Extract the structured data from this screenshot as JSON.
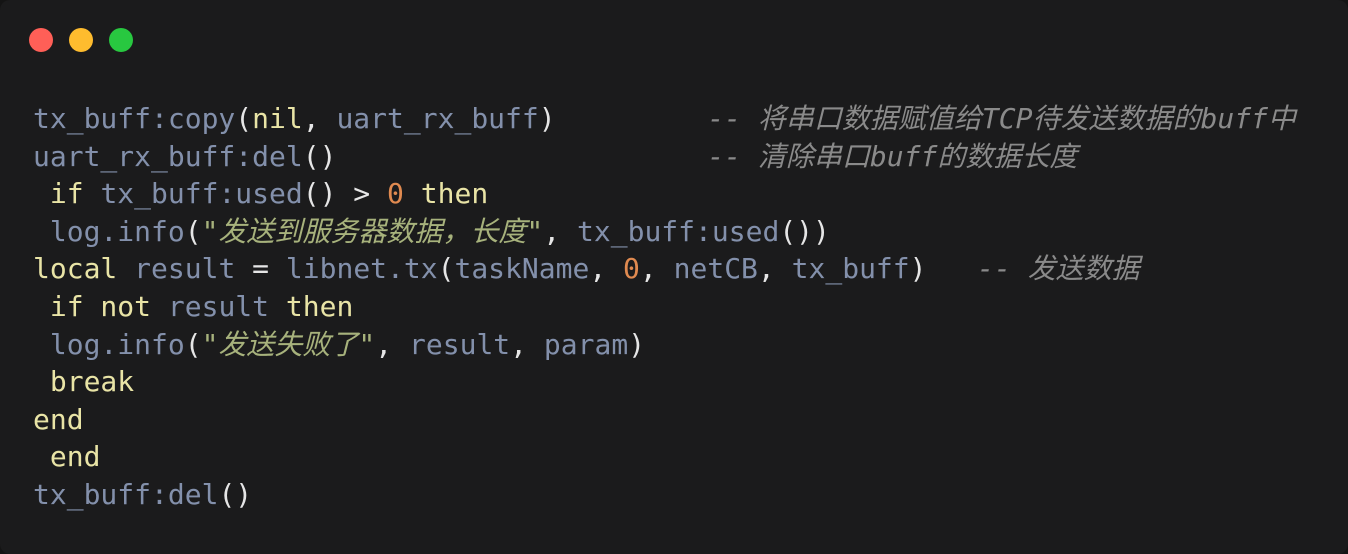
{
  "window": {
    "buttons": [
      {
        "name": "close-button",
        "color": "#ff5f57"
      },
      {
        "name": "minimize-button",
        "color": "#febc2e"
      },
      {
        "name": "maximize-button",
        "color": "#28c840"
      }
    ]
  },
  "colors": {
    "ident": "#8390ab",
    "keyword": "#e9e4a6",
    "number": "#e08a50",
    "string": "#a7b27c",
    "comment": "#8a8a8a",
    "punct": "#e6e6e6"
  },
  "code": {
    "language": "lua",
    "lines": [
      [
        [
          "ident",
          "tx_buff:copy"
        ],
        [
          "punct",
          "("
        ],
        [
          "keyword",
          "nil"
        ],
        [
          "punct",
          ", "
        ],
        [
          "ident",
          "uart_rx_buff"
        ],
        [
          "punct",
          ")"
        ],
        [
          "punct",
          "         "
        ],
        [
          "comment",
          "-- 将串口数据赋值给TCP待发送数据的buff中"
        ]
      ],
      [
        [
          "ident",
          "uart_rx_buff:del"
        ],
        [
          "punct",
          "()"
        ],
        [
          "punct",
          "                      "
        ],
        [
          "comment",
          "-- 清除串口buff的数据长度"
        ]
      ],
      [
        [
          "punct",
          " "
        ],
        [
          "keyword",
          "if"
        ],
        [
          "punct",
          " "
        ],
        [
          "ident",
          "tx_buff:used"
        ],
        [
          "punct",
          "() > "
        ],
        [
          "number",
          "0"
        ],
        [
          "punct",
          " "
        ],
        [
          "keyword",
          "then"
        ]
      ],
      [
        [
          "punct",
          " "
        ],
        [
          "ident",
          "log.info"
        ],
        [
          "punct",
          "("
        ],
        [
          "string",
          "\"发送到服务器数据，长度\""
        ],
        [
          "punct",
          ", "
        ],
        [
          "ident",
          "tx_buff:used"
        ],
        [
          "punct",
          "())"
        ]
      ],
      [
        [
          "keyword",
          "local"
        ],
        [
          "punct",
          " "
        ],
        [
          "ident",
          "result"
        ],
        [
          "punct",
          " = "
        ],
        [
          "ident",
          "libnet.tx"
        ],
        [
          "punct",
          "("
        ],
        [
          "ident",
          "taskName"
        ],
        [
          "punct",
          ", "
        ],
        [
          "number",
          "0"
        ],
        [
          "punct",
          ", "
        ],
        [
          "ident",
          "netCB"
        ],
        [
          "punct",
          ", "
        ],
        [
          "ident",
          "tx_buff"
        ],
        [
          "punct",
          ")"
        ],
        [
          "punct",
          "   "
        ],
        [
          "comment",
          "-- 发送数据"
        ]
      ],
      [
        [
          "punct",
          " "
        ],
        [
          "keyword",
          "if not"
        ],
        [
          "punct",
          " "
        ],
        [
          "ident",
          "result"
        ],
        [
          "punct",
          " "
        ],
        [
          "keyword",
          "then"
        ]
      ],
      [
        [
          "punct",
          " "
        ],
        [
          "ident",
          "log.info"
        ],
        [
          "punct",
          "("
        ],
        [
          "string",
          "\"发送失败了\""
        ],
        [
          "punct",
          ", "
        ],
        [
          "ident",
          "result"
        ],
        [
          "punct",
          ", "
        ],
        [
          "ident",
          "param"
        ],
        [
          "punct",
          ")"
        ]
      ],
      [
        [
          "punct",
          " "
        ],
        [
          "keyword",
          "break"
        ]
      ],
      [
        [
          "keyword",
          "end"
        ]
      ],
      [
        [
          "punct",
          " "
        ],
        [
          "keyword",
          "end"
        ]
      ],
      [
        [
          "ident",
          "tx_buff:del"
        ],
        [
          "punct",
          "()"
        ]
      ]
    ]
  }
}
